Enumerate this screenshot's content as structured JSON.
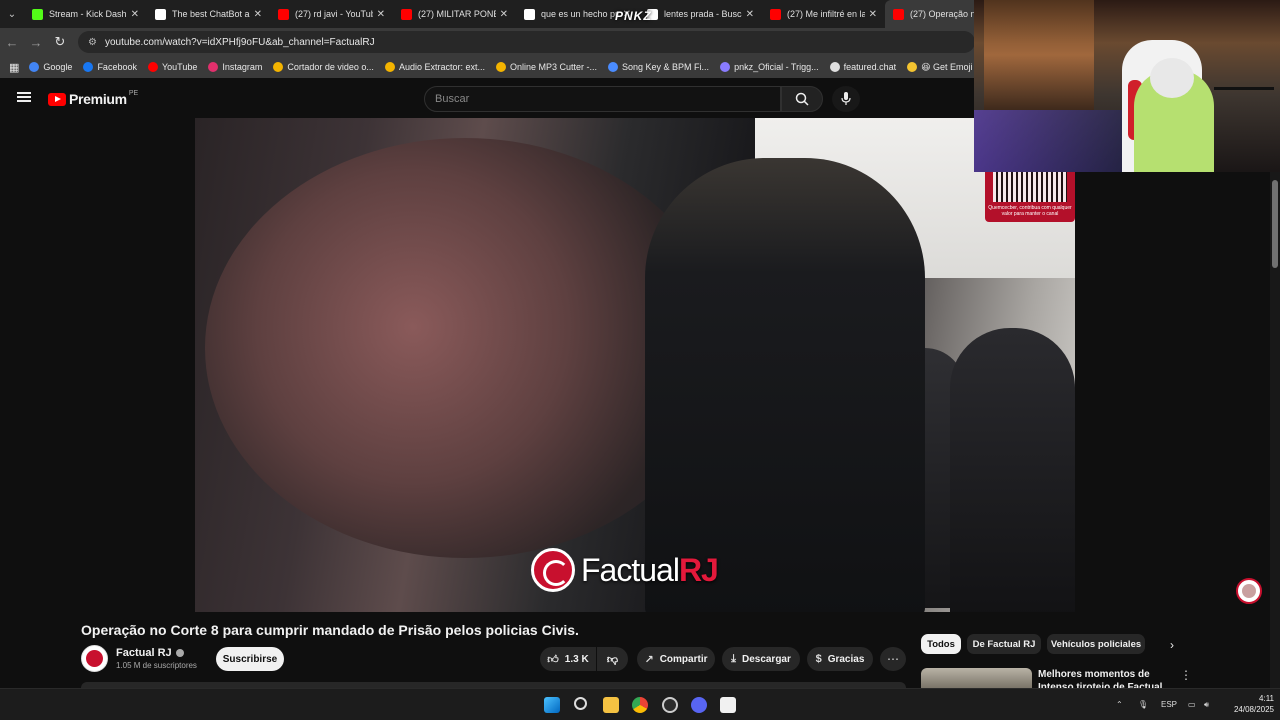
{
  "browser": {
    "tabs": [
      {
        "title": "Stream - Kick Dashbo",
        "color": "#53fc18"
      },
      {
        "title": "The best ChatBot and",
        "color": "#ffffff"
      },
      {
        "title": "(27) rd javi - YouTube",
        "color": "#ff0000"
      },
      {
        "title": "(27) MILITAR PONE E",
        "color": "#ff0000"
      },
      {
        "title": "que es un hecho pu",
        "color": "#ffffff"
      },
      {
        "title": "lentes prada - Buscar",
        "color": "#ffffff"
      },
      {
        "title": "(27) Me infiltré en la",
        "color": "#ff0000"
      },
      {
        "title": "(27) Operação no",
        "color": "#ff0000"
      }
    ],
    "url": "youtube.com/watch?v=idXPHfj9oFU&ab_channel=FactualRJ",
    "bookmarks": [
      {
        "label": "Google",
        "color": "#4285f4"
      },
      {
        "label": "Facebook",
        "color": "#1877f2"
      },
      {
        "label": "YouTube",
        "color": "#ff0000"
      },
      {
        "label": "Instagram",
        "color": "#e1306c"
      },
      {
        "label": "Cortador de video o...",
        "color": "#f4b400"
      },
      {
        "label": "Audio Extractor: ext...",
        "color": "#f4b400"
      },
      {
        "label": "Online MP3 Cutter -...",
        "color": "#f4b400"
      },
      {
        "label": "Song Key & BPM Fi...",
        "color": "#4a8cff"
      },
      {
        "label": "pnkz_Oficial - Trigg...",
        "color": "#8a7cff"
      },
      {
        "label": "featured.chat",
        "color": "#e0e0e0"
      },
      {
        "label": "😆 Get Emoji — All...",
        "color": "#f4c430"
      },
      {
        "label": "C",
        "color": "#cccccc"
      }
    ]
  },
  "youtube": {
    "logo_text": "Premium",
    "region": "PE",
    "search_placeholder": "Buscar"
  },
  "overlay": {
    "webcam_label": "PNKZ",
    "qr_caption": "Quemcecber, contribua com qualquer valor para manter o canal"
  },
  "video": {
    "watermark_main": "Factual",
    "watermark_accent": "RJ",
    "title": "Operação no Corte 8 para cumprir mandado de Prisão pelos policias Civis.",
    "channel_name": "Factual RJ",
    "subscribers": "1.05 M de suscriptores",
    "subscribe_label": "Suscribirse",
    "likes": "1.3 K",
    "share_label": "Compartir",
    "download_label": "Descargar",
    "thanks_label": "Gracias"
  },
  "sidebar": {
    "chips": [
      "Todos",
      "De Factual RJ",
      "Vehículos policiales"
    ],
    "rec_title": "Melhores momentos de Intenso tiroteio de Factual RJ"
  },
  "taskbar": {
    "lang": "ESP",
    "time": "4:11",
    "date": "24/08/2025"
  }
}
